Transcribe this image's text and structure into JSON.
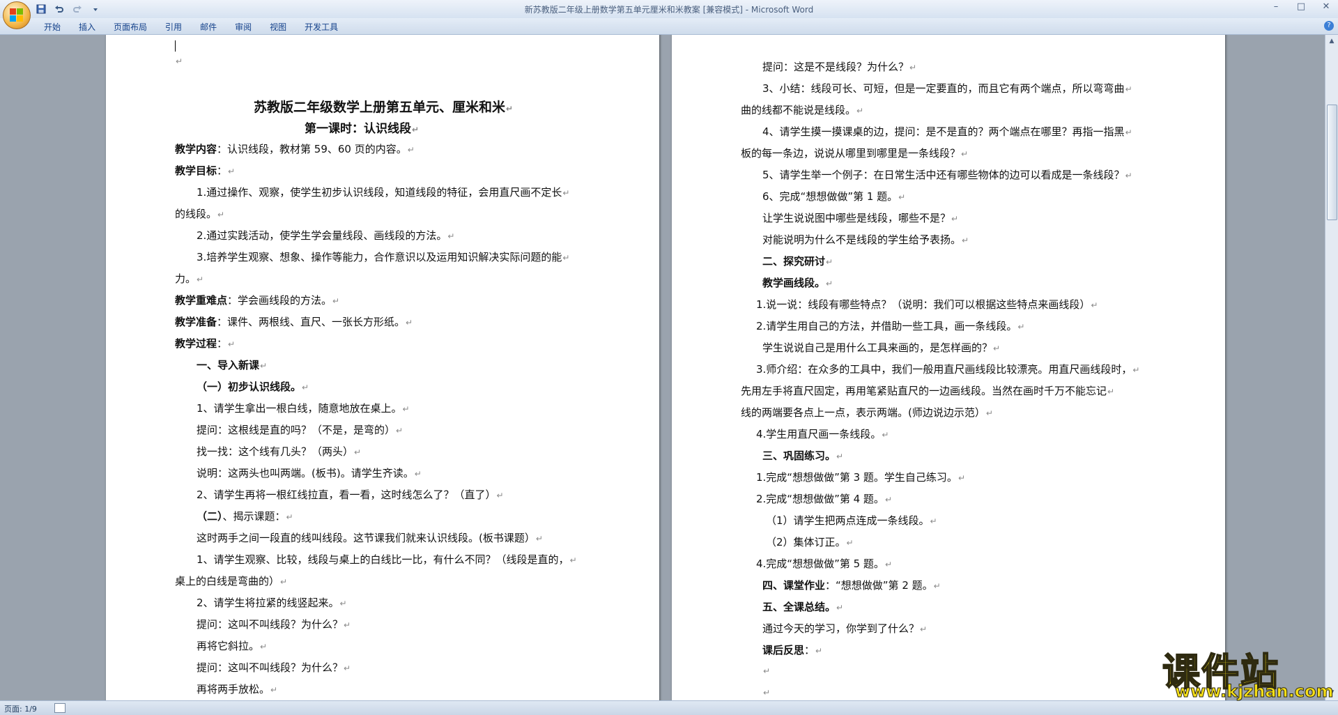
{
  "window": {
    "title": "新苏教版二年级上册数学第五单元厘米和米教案 [兼容模式] - Microsoft Word",
    "controls": [
      "–",
      "□",
      "✕"
    ]
  },
  "quick_access": [
    "save-icon",
    "undo-icon",
    "redo-icon",
    "customize-icon"
  ],
  "ribbon": {
    "tabs": [
      "开始",
      "插入",
      "页面布局",
      "引用",
      "邮件",
      "审阅",
      "视图",
      "开发工具"
    ],
    "help": "?"
  },
  "doc": {
    "left": [
      {
        "text": "苏教版二年级数学上册第五单元、厘米和米"
      },
      {
        "text": "第一课时：认识线段"
      },
      {
        "bold": "教学内容",
        "text": "：认识线段，教材第 59、60 页的内容。"
      },
      {
        "bold": "教学目标",
        "text": "："
      },
      {
        "text": "1.通过操作、观察，使学生初步认识线段，知道线段的特征，会用直尺画不定长"
      },
      {
        "text": "的线段。"
      },
      {
        "text": "2.通过实践活动，使学生学会量线段、画线段的方法。"
      },
      {
        "text": "3.培养学生观察、想象、操作等能力，合作意识以及运用知识解决实际问题的能"
      },
      {
        "text": "力。"
      },
      {
        "bold": "教学重难点",
        "text": "：学会画线段的方法。"
      },
      {
        "bold": "教学准备",
        "text": "：课件、两根线、直尺、一张长方形纸。"
      },
      {
        "bold": "教学过程",
        "text": "："
      },
      {
        "bold": "一、导入新课",
        "text": ""
      },
      {
        "bold": "（一）初步认识线段。",
        "text": ""
      },
      {
        "text": "1、请学生拿出一根白线，随意地放在桌上。"
      },
      {
        "text": "提问：这根线是直的吗？（不是，是弯的）"
      },
      {
        "text": "找一找：这个线有几头？（两头）"
      },
      {
        "text": "说明：这两头也叫两端。(板书)。请学生齐读。"
      },
      {
        "text": "2、请学生再将一根红线拉直，看一看，这时线怎么了？（直了）"
      },
      {
        "bold": "（二）",
        "text": "、揭示课题："
      },
      {
        "text": "这时两手之间一段直的线叫线段。这节课我们就来认识线段。(板书课题）"
      },
      {
        "text": "1、请学生观察、比较，线段与桌上的白线比一比，有什么不同？（线段是直的，"
      },
      {
        "text": "桌上的白线是弯曲的）"
      },
      {
        "text": "2、请学生将拉紧的线竖起来。"
      },
      {
        "text": "提问：这叫不叫线段？为什么？"
      },
      {
        "text": "再将它斜拉。"
      },
      {
        "text": "提问：这叫不叫线段？为什么？"
      },
      {
        "text": "再将两手放松。"
      }
    ],
    "right": [
      {
        "text": "提问：这是不是线段？为什么？"
      },
      {
        "text": "3、小结：线段可长、可短，但是一定要直的，而且它有两个端点，所以弯弯曲"
      },
      {
        "text": "曲的线都不能说是线段。"
      },
      {
        "text": "4、请学生摸一摸课桌的边，提问：是不是直的？两个端点在哪里？再指一指黑"
      },
      {
        "text": "板的每一条边，说说从哪里到哪里是一条线段？"
      },
      {
        "text": "5、请学生举一个例子：在日常生活中还有哪些物体的边可以看成是一条线段？"
      },
      {
        "text": "6、完成“想想做做”第 1 题。"
      },
      {
        "text": "让学生说说图中哪些是线段，哪些不是？"
      },
      {
        "text": "对能说明为什么不是线段的学生给予表扬。"
      },
      {
        "bold": "二、探究研讨",
        "text": ""
      },
      {
        "bold": "教学画线段。",
        "text": ""
      },
      {
        "text": "1.说一说：线段有哪些特点？（说明：我们可以根据这些特点来画线段）"
      },
      {
        "text": "2.请学生用自己的方法，并借助一些工具，画一条线段。"
      },
      {
        "text": "学生说说自己是用什么工具来画的，是怎样画的？"
      },
      {
        "text": "3.师介绍：在众多的工具中，我们一般用直尺画线段比较漂亮。用直尺画线段时，"
      },
      {
        "text": "先用左手将直尺固定，再用笔紧贴直尺的一边画线段。当然在画时千万不能忘记"
      },
      {
        "text": "线的两端要各点上一点，表示两端。(师边说边示范）"
      },
      {
        "text": "4.学生用直尺画一条线段。"
      },
      {
        "bold": "三、巩固练习。",
        "text": ""
      },
      {
        "text": "1.完成“想想做做”第 3 题。学生自己练习。"
      },
      {
        "text": "2.完成“想想做做”第 4 题。"
      },
      {
        "text": "（1）请学生把两点连成一条线段。"
      },
      {
        "text": "（2）集体订正。"
      },
      {
        "text": "4.完成“想想做做”第 5 题。"
      },
      {
        "bold": "四、课堂作业",
        "text": "：“想想做做”第 2 题。"
      },
      {
        "bold": "五、全课总结。",
        "text": ""
      },
      {
        "text": "通过今天的学习，你学到了什么？"
      },
      {
        "bold": "课后反思",
        "text": "："
      },
      {
        "text": ""
      },
      {
        "text": ""
      }
    ]
  },
  "status": {
    "page": "页面: 1/9"
  },
  "watermark": {
    "name": "课件站",
    "url": "www.kjzhan.com"
  }
}
